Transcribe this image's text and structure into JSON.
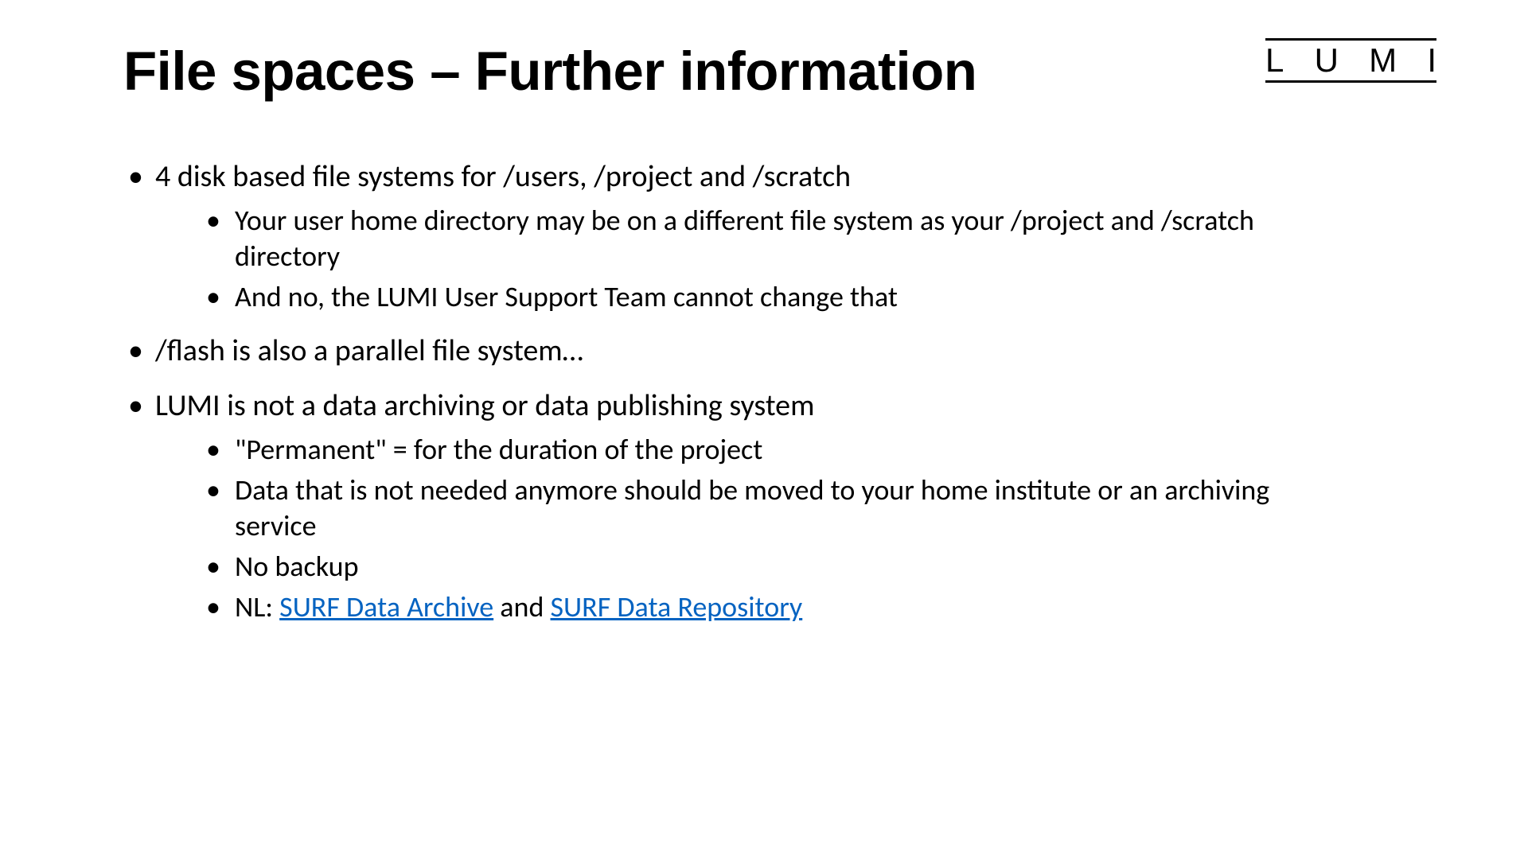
{
  "slide": {
    "title": "File spaces – Further information",
    "logo": {
      "l": "L",
      "u": "U",
      "m": "M",
      "i": "I"
    },
    "bullets": {
      "b1": {
        "text": "4 disk based file systems for /users, /project and /scratch",
        "sub": {
          "s1": "Your user home directory may be on a different file system as your /project and /scratch directory",
          "s2": "And no, the LUMI User Support Team cannot change that"
        }
      },
      "b2": {
        "text": "/flash is also a parallel file system…"
      },
      "b3": {
        "text": "LUMI is not a data archiving or data publishing system",
        "sub": {
          "s1": "\"Permanent\" = for the duration of the project",
          "s2": "Data that is not needed anymore should be moved to your home institute or an archiving service",
          "s3": "No backup",
          "s4_prefix": "NL: ",
          "s4_link1": "SURF Data Archive",
          "s4_mid": " and ",
          "s4_link2": "SURF Data Repository"
        }
      }
    }
  }
}
